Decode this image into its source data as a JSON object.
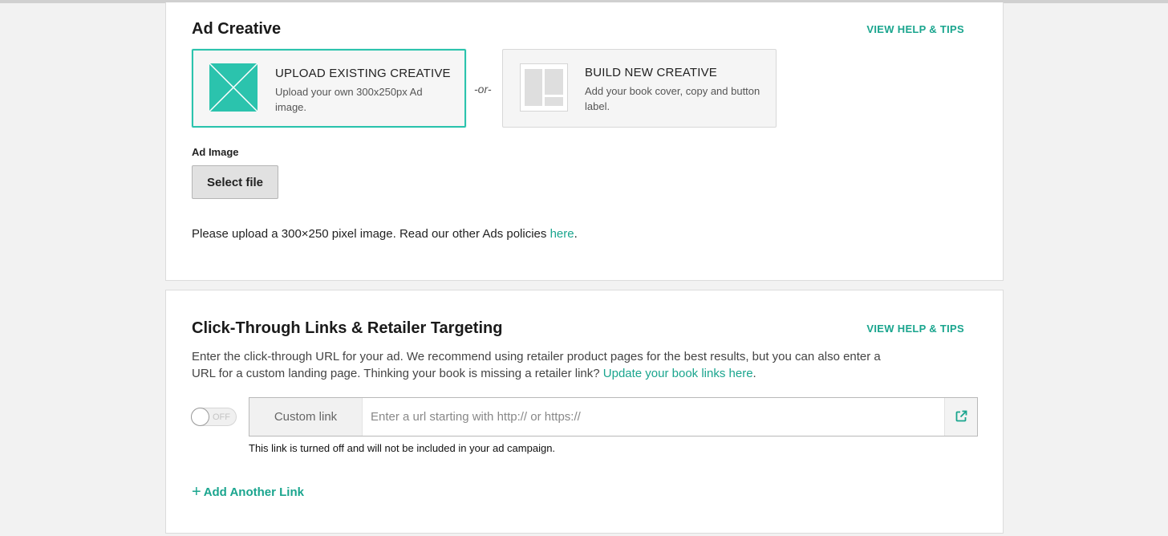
{
  "ad_creative": {
    "title": "Ad Creative",
    "help_link": "VIEW HELP & TIPS",
    "options": [
      {
        "title": "UPLOAD EXISTING CREATIVE",
        "description": "Upload your own 300x250px Ad image.",
        "icon": "image-placeholder-icon",
        "selected": true
      },
      {
        "title": "BUILD NEW CREATIVE",
        "description": "Add your book cover, copy and button label.",
        "icon": "layout-template-icon",
        "selected": false
      }
    ],
    "separator": "-or-",
    "ad_image_label": "Ad Image",
    "select_file_label": "Select file",
    "policy_text": "Please upload a 300×250 pixel image. Read our other Ads policies ",
    "policy_link": "here",
    "policy_end": "."
  },
  "click_through": {
    "title": "Click-Through Links & Retailer Targeting",
    "help_link": "VIEW HELP & TIPS",
    "description": "Enter the click-through URL for your ad. We recommend using retailer product pages for the best results, but you can also enter a URL for a custom landing page. Thinking your book is missing a retailer link? ",
    "update_link": "Update your book links here",
    "description_end": ".",
    "toggle_label": "OFF",
    "toggle_on": false,
    "link_prefix": "Custom link",
    "url_value": "",
    "url_placeholder": "Enter a url starting with http:// or https://",
    "link_note": "This link is turned off and will not be included in your ad campaign.",
    "add_link_icon": "+",
    "add_link_label": "Add Another Link"
  },
  "colors": {
    "accent": "#1aa58e",
    "selected_border": "#2bc3ad",
    "thumb_fill": "#2bc3ad"
  }
}
